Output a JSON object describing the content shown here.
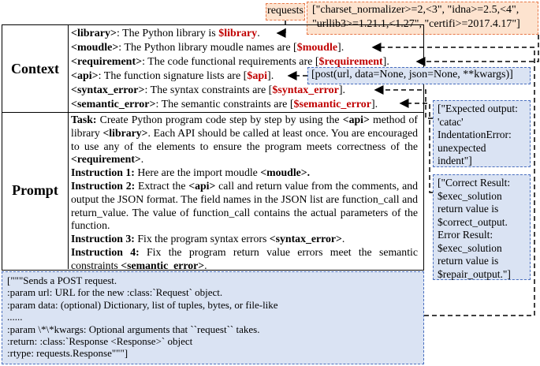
{
  "context_label": "Context",
  "prompt_label": "Prompt",
  "context_lines": [
    {
      "tag": "<library>",
      "text": ": The Python library is ",
      "var": "$library",
      "tail": "."
    },
    {
      "tag": "<moudle>",
      "text": ": The Python library moudle names are [",
      "var": "$moudle",
      "tail": "]."
    },
    {
      "tag": "<requirement>",
      "text": ": The code functional requirements are [",
      "var": "$requirement",
      "tail": "]."
    },
    {
      "tag": "<api>",
      "text": ": The function signature lists are [",
      "var": "$api",
      "tail": "]."
    },
    {
      "tag": "<syntax_error>",
      "text": ": The syntax constraints are [",
      "var": "$syntax_error",
      "tail": "]."
    },
    {
      "tag": "<semantic_error>",
      "text": ": The semantic constraints are [",
      "var": "$semantic_error",
      "tail": "]."
    }
  ],
  "prompt": {
    "task_label": "Task:",
    "task_text_1": " Create Python program code step by step by using the ",
    "task_api": "<api>",
    "task_text_2": " method of library ",
    "task_library": "<library>",
    "task_text_3": ". Each API should be called at least once. You are encouraged to use any of the elements to ensure the program meets correctness of the ",
    "task_requirement": "<requirement>",
    "task_text_4": ".",
    "i1_label": "Instruction 1:",
    "i1_text": " Here are the import moudle ",
    "i1_tag": "<moudle>.",
    "i2_label": "Instruction 2:",
    "i2_text_1": " Extract the ",
    "i2_api": "<api>",
    "i2_text_2": " call and return value from the comments, and output the JSON format. The field names in the JSON list are function_call and return_value. The value of function_call contains the actual parameters of the function.",
    "i3_label": "Instruction 3:",
    "i3_text": "  Fix the program syntax errors ",
    "i3_tag": "<syntax_error>",
    "i3_tail": ".",
    "i4_label": "Instruction 4:",
    "i4_text": " Fix the program return value errors meet the semantic constraints ",
    "i4_tag": "<semantic_error>",
    "i4_tail": "."
  },
  "requests_box": "requests",
  "requirement_box": [
    "[\"charset_normalizer>=2,<3\", \"idna>=2.5,<4\",",
    "\"urllib3>=1.21.1,<1.27\", \"certifi>=2017.4.17\"]"
  ],
  "api_box": "[post(url, data=None, json=None, **kwargs)]",
  "syntax_box": [
    "[\"Expected output:",
    "'catac'",
    "IndentationError:",
    "unexpected",
    "indent\"]"
  ],
  "semantic_box": [
    "[\"Correct Result:",
    "$exec_solution",
    "return value is",
    "$correct_output.",
    "Error Result:",
    "$exec_solution",
    "return value is",
    "$repair_output.\"]"
  ],
  "doc_lines": [
    "[\"\"\"Sends a POST request.",
    ":param url: URL for the new :class:`Request` object.",
    ":param data: (optional) Dictionary, list of tuples, bytes, or file-like",
    "......",
    ":param \\*\\*kwargs: Optional arguments that ``request`` takes.",
    ":return: :class:`Response <Response>` object",
    ":rtype: requests.Response\"\"\"]"
  ],
  "colors": {
    "red": "#c00000",
    "orange_fill": "#fde3cf",
    "orange_border": "#e8794a",
    "blue_fill": "#dae3f3",
    "blue_border": "#4a6fbf"
  }
}
